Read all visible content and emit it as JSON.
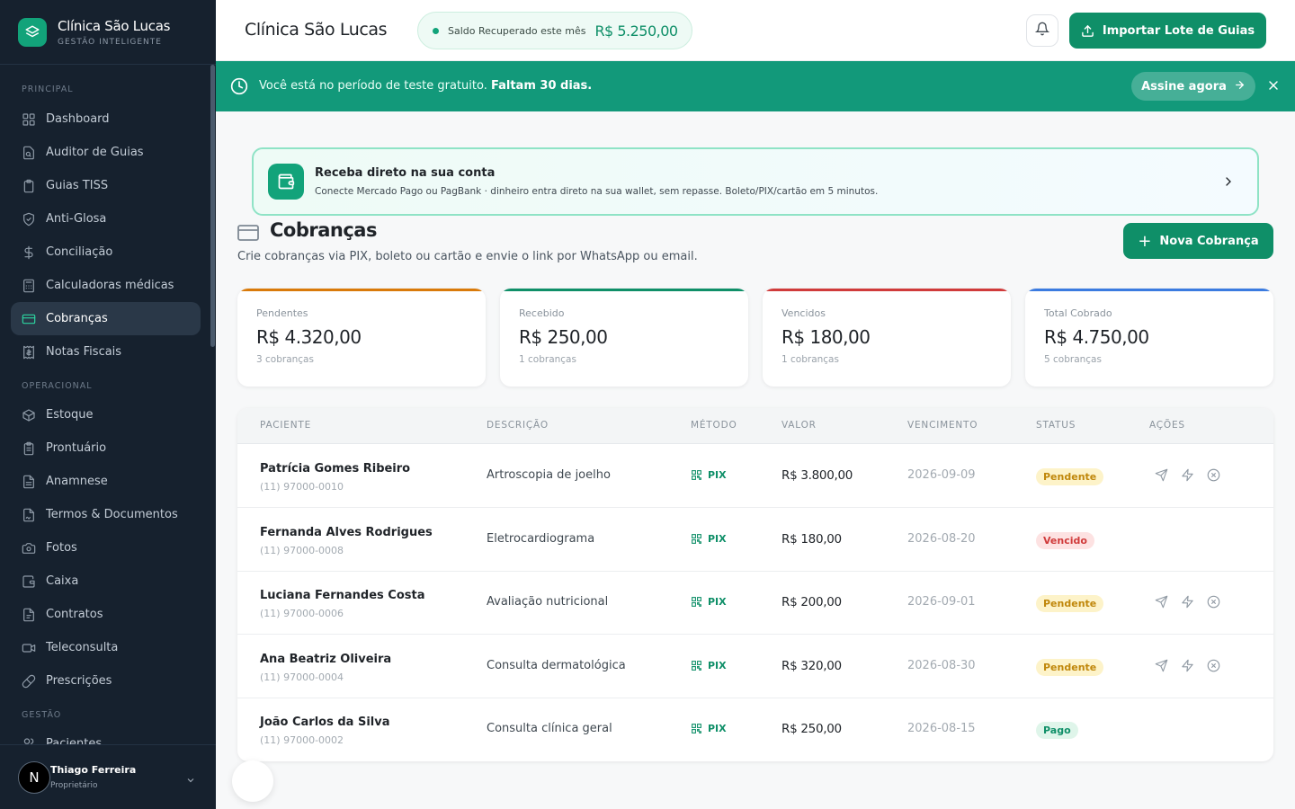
{
  "brand": {
    "name": "Clínica São Lucas",
    "tagline": "GESTÃO INTELIGENTE"
  },
  "sidebar": {
    "sections": [
      "PRINCIPAL",
      "OPERACIONAL",
      "GESTÃO"
    ],
    "items": [
      {
        "label": "Dashboard",
        "icon": "grid-icon"
      },
      {
        "label": "Auditor de Guias",
        "icon": "file-search-icon"
      },
      {
        "label": "Guias TISS",
        "icon": "clipboard-icon"
      },
      {
        "label": "Anti-Glosa",
        "icon": "shield-icon"
      },
      {
        "label": "Conciliação",
        "icon": "dollar-icon"
      },
      {
        "label": "Calculadoras médicas",
        "icon": "calculator-icon"
      },
      {
        "label": "Cobranças",
        "icon": "credit-card-icon",
        "active": true
      },
      {
        "label": "Notas Fiscais",
        "icon": "receipt-icon"
      },
      {
        "label": "Estoque",
        "icon": "box-icon"
      },
      {
        "label": "Prontuário",
        "icon": "clipboard-list-icon"
      },
      {
        "label": "Anamnese",
        "icon": "document-icon"
      },
      {
        "label": "Termos & Documentos",
        "icon": "file-signature-icon"
      },
      {
        "label": "Fotos",
        "icon": "camera-icon"
      },
      {
        "label": "Caixa",
        "icon": "wallet-icon"
      },
      {
        "label": "Contratos",
        "icon": "contract-icon"
      },
      {
        "label": "Teleconsulta",
        "icon": "video-icon"
      },
      {
        "label": "Prescrições",
        "icon": "pill-icon"
      },
      {
        "label": "Pacientes",
        "icon": "users-icon"
      }
    ]
  },
  "user": {
    "initial": "N",
    "name": "Thiago Ferreira",
    "role": "Proprietário"
  },
  "header": {
    "title": "Clínica São Lucas",
    "saldo_label": "Saldo Recuperado este mês",
    "saldo_value": "R$ 5.250,00",
    "import_label": "Importar Lote de Guias"
  },
  "trial": {
    "text": "Você está no período de teste gratuito.",
    "days": "Faltam 30 dias.",
    "cta": "Assine agora"
  },
  "promo": {
    "title": "Receba direto na sua conta",
    "subtitle": "Conecte Mercado Pago ou PagBank · dinheiro entra direto na sua wallet, sem repasse. Boleto/PIX/cartão em 5 minutos."
  },
  "page": {
    "title": "Cobranças",
    "subtitle": "Crie cobranças via PIX, boleto ou cartão e envie o link por WhatsApp ou email.",
    "new_button": "Nova Cobrança"
  },
  "stats": [
    {
      "label": "Pendentes",
      "value": "R$ 4.320,00",
      "count": "3 cobranças",
      "color": "#d97a0a"
    },
    {
      "label": "Recebido",
      "value": "R$ 250,00",
      "count": "1 cobranças",
      "color": "#0f8f68"
    },
    {
      "label": "Vencidos",
      "value": "R$ 180,00",
      "count": "1 cobranças",
      "color": "#d03b3b"
    },
    {
      "label": "Total Cobrado",
      "value": "R$ 4.750,00",
      "count": "5 cobranças",
      "color": "#3b7be0"
    }
  ],
  "table": {
    "headers": [
      "PACIENTE",
      "DESCRIÇÃO",
      "MÉTODO",
      "VALOR",
      "VENCIMENTO",
      "STATUS",
      "AÇÕES"
    ],
    "rows": [
      {
        "name": "Patrícia Gomes Ribeiro",
        "phone": "(11) 97000-0010",
        "desc": "Artroscopia de joelho",
        "method": "PIX",
        "valor": "R$ 3.800,00",
        "venc": "2026-09-09",
        "status": "Pendente",
        "status_kind": "pendente",
        "actions": true
      },
      {
        "name": "Fernanda Alves Rodrigues",
        "phone": "(11) 97000-0008",
        "desc": "Eletrocardiograma",
        "method": "PIX",
        "valor": "R$ 180,00",
        "venc": "2026-08-20",
        "status": "Vencido",
        "status_kind": "vencido",
        "actions": false
      },
      {
        "name": "Luciana Fernandes Costa",
        "phone": "(11) 97000-0006",
        "desc": "Avaliação nutricional",
        "method": "PIX",
        "valor": "R$ 200,00",
        "venc": "2026-09-01",
        "status": "Pendente",
        "status_kind": "pendente",
        "actions": true
      },
      {
        "name": "Ana Beatriz Oliveira",
        "phone": "(11) 97000-0004",
        "desc": "Consulta dermatológica",
        "method": "PIX",
        "valor": "R$ 320,00",
        "venc": "2026-08-30",
        "status": "Pendente",
        "status_kind": "pendente",
        "actions": true
      },
      {
        "name": "João Carlos da Silva",
        "phone": "(11) 97000-0002",
        "desc": "Consulta clínica geral",
        "method": "PIX",
        "valor": "R$ 250,00",
        "venc": "2026-08-15",
        "status": "Pago",
        "status_kind": "pago",
        "actions": false
      }
    ]
  }
}
